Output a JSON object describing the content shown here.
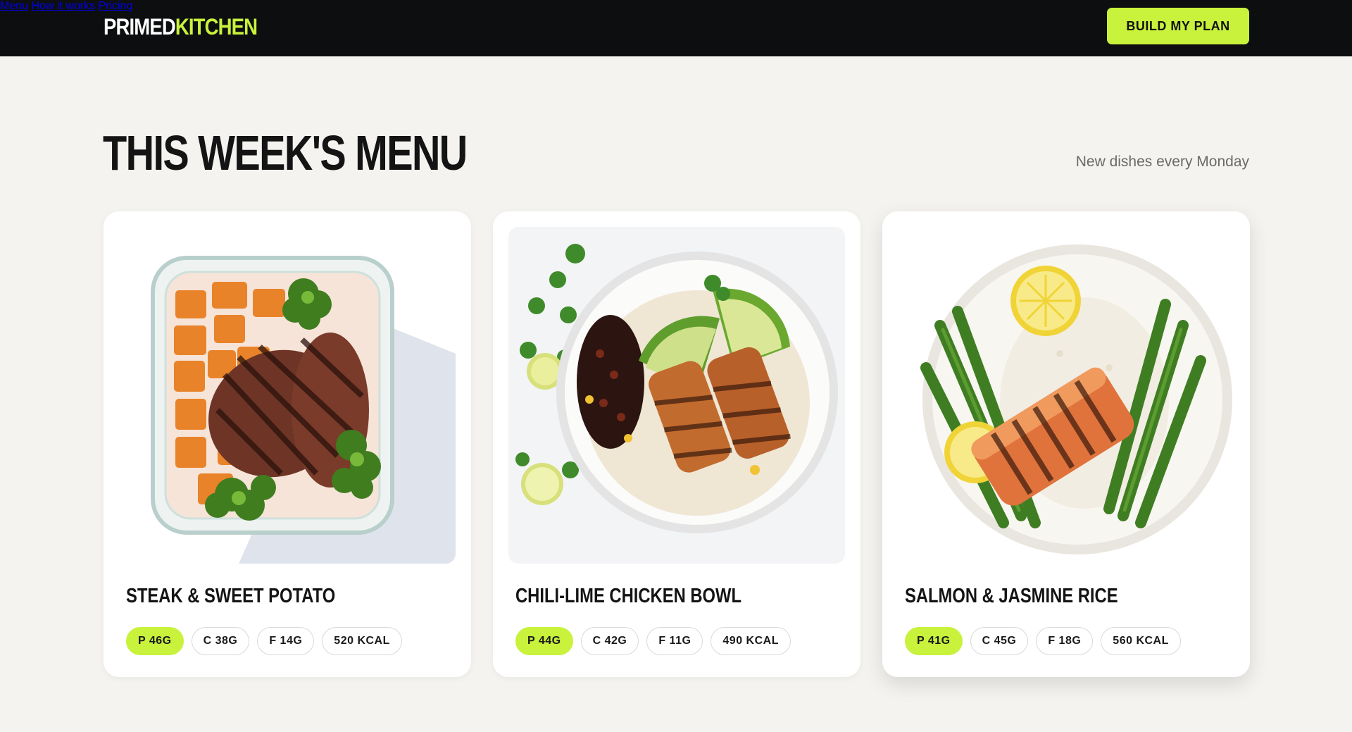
{
  "brand": {
    "part1": "PRIMED",
    "part2": "KITCHEN",
    "accent": "#c8f23c"
  },
  "nav": {
    "items": [
      "Menu",
      "How it works",
      "Pricing"
    ]
  },
  "cta": {
    "label": "BUILD MY PLAN"
  },
  "section": {
    "title": "THIS WEEK'S MENU",
    "subtitle": "New dishes every Monday"
  },
  "dishes": [
    {
      "name": "STEAK & SWEET POTATO",
      "image": "steak-sweet-potato-meal-prep-photo",
      "macros": {
        "protein": "P 46G",
        "carbs": "C 38G",
        "fat": "F 14G",
        "kcal": "520 KCAL"
      }
    },
    {
      "name": "CHILI-LIME CHICKEN BOWL",
      "image": "chili-lime-chicken-bowl-photo",
      "macros": {
        "protein": "P 44G",
        "carbs": "C 42G",
        "fat": "F 11G",
        "kcal": "490 KCAL"
      }
    },
    {
      "name": "SALMON & JASMINE RICE",
      "image": "salmon-jasmine-rice-photo",
      "macros": {
        "protein": "P 41G",
        "carbs": "C 45G",
        "fat": "F 18G",
        "kcal": "560 KCAL"
      }
    }
  ]
}
